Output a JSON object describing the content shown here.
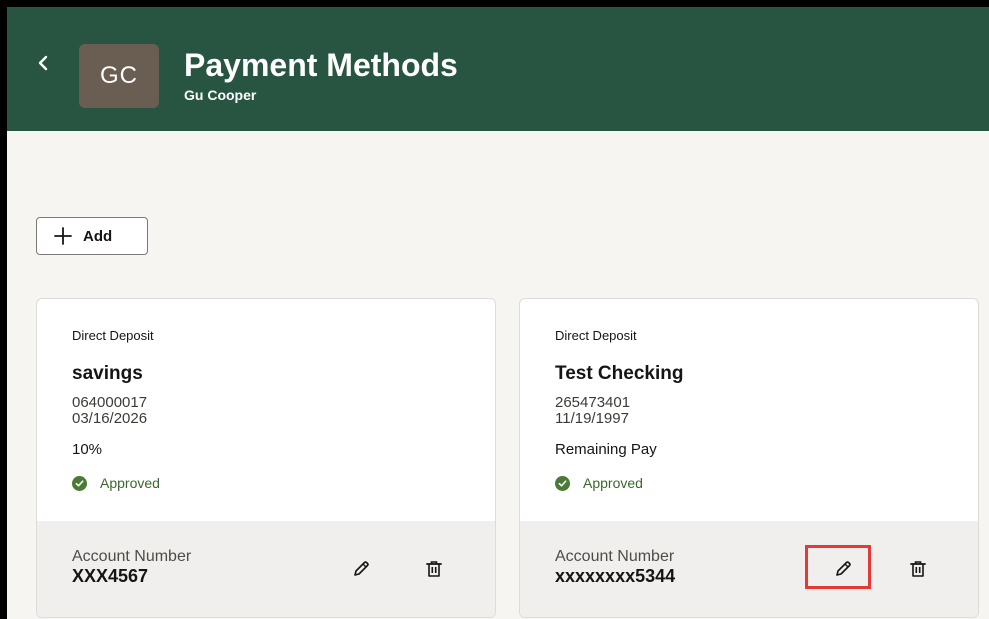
{
  "header": {
    "avatar_initials": "GC",
    "title": "Payment Methods",
    "subtitle": "Gu Cooper",
    "back_icon": "chevron-left-icon",
    "background_color": "#275542"
  },
  "toolbar": {
    "add_label": "Add",
    "add_icon": "plus-icon"
  },
  "cards": [
    {
      "type": "Direct Deposit",
      "name": "savings",
      "routing": "064000017",
      "date": "03/16/2026",
      "amount": "10%",
      "status": "Approved",
      "account_label": "Account Number",
      "account_number": "XXX4567",
      "edit_icon": "pencil-icon",
      "delete_icon": "trash-icon"
    },
    {
      "type": "Direct Deposit",
      "name": "Test Checking",
      "routing": "265473401",
      "date": "11/19/1997",
      "amount": "Remaining Pay",
      "status": "Approved",
      "account_label": "Account Number",
      "account_number": "xxxxxxxx5344",
      "edit_icon": "pencil-icon",
      "delete_icon": "trash-icon"
    }
  ],
  "colors": {
    "approved": "#4b7a36",
    "highlight": "#e53935"
  }
}
